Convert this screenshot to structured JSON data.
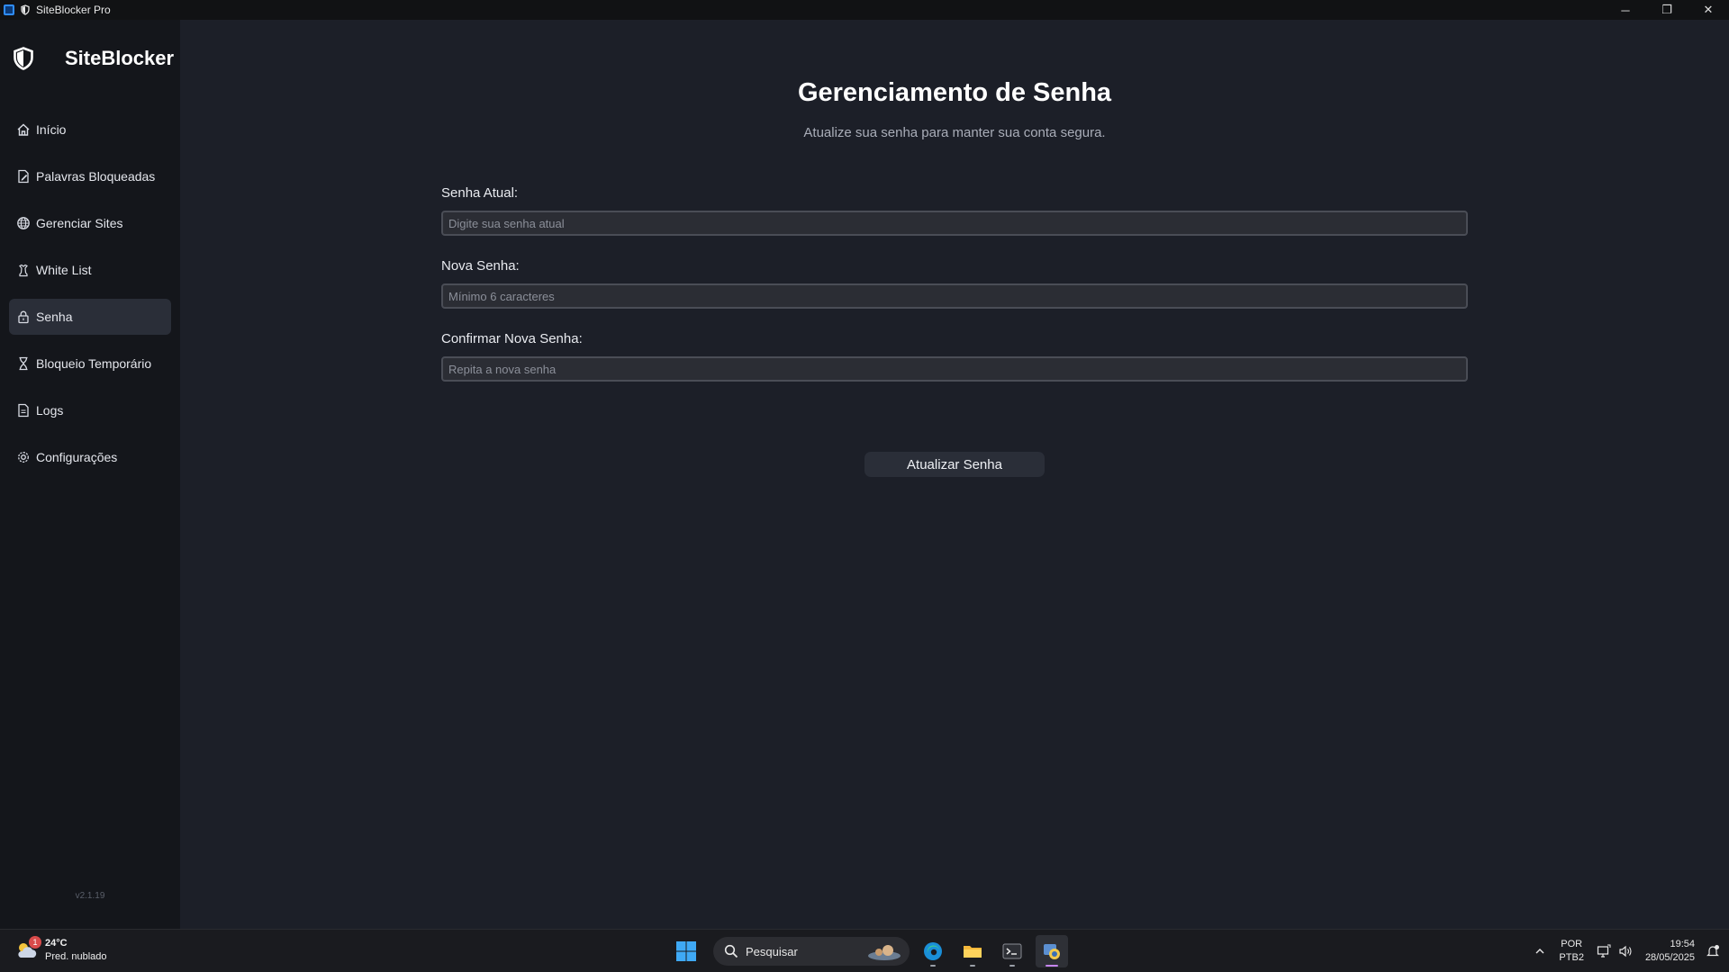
{
  "window": {
    "title": "SiteBlocker Pro",
    "minimize": "─",
    "maximize": "❐",
    "close": "✕"
  },
  "sidebar": {
    "brand": "SiteBlocker",
    "items": [
      {
        "label": "Início",
        "icon": "home-icon",
        "active": false
      },
      {
        "label": "Palavras Bloqueadas",
        "icon": "edit-document-icon",
        "active": false
      },
      {
        "label": "Gerenciar Sites",
        "icon": "globe-icon",
        "active": false
      },
      {
        "label": "White List",
        "icon": "chess-piece-icon",
        "active": false
      },
      {
        "label": "Senha",
        "icon": "lock-icon",
        "active": true
      },
      {
        "label": "Bloqueio Temporário",
        "icon": "hourglass-icon",
        "active": false
      },
      {
        "label": "Logs",
        "icon": "document-icon",
        "active": false
      },
      {
        "label": "Configurações",
        "icon": "gear-icon",
        "active": false
      }
    ],
    "version": "v2.1.19"
  },
  "main": {
    "title": "Gerenciamento de Senha",
    "subtitle": "Atualize sua senha para manter sua conta segura.",
    "fields": {
      "current": {
        "label": "Senha Atual:",
        "placeholder": "Digite sua senha atual",
        "value": ""
      },
      "new": {
        "label": "Nova Senha:",
        "placeholder": "Mínimo 6 caracteres",
        "value": ""
      },
      "confirm": {
        "label": "Confirmar Nova Senha:",
        "placeholder": "Repita a nova senha",
        "value": ""
      }
    },
    "submit_label": "Atualizar Senha"
  },
  "taskbar": {
    "weather": {
      "temp": "24°C",
      "desc": "Pred. nublado",
      "badge": "1"
    },
    "search_label": "Pesquisar",
    "apps": [
      "edge-icon",
      "file-explorer-icon",
      "terminal-icon",
      "python-app-icon"
    ],
    "tray": {
      "lang_line1": "POR",
      "lang_line2": "PTB2",
      "time": "19:54",
      "date": "28/05/2025"
    }
  },
  "colors": {
    "background": "#1c1f28",
    "sidebar": "#14161b",
    "active_item": "#2a2e38",
    "input_bg": "#2b2d34"
  }
}
